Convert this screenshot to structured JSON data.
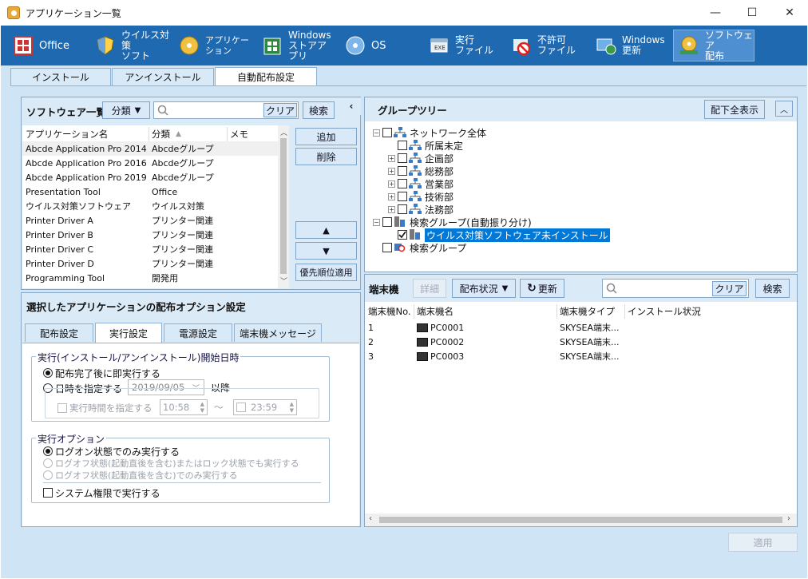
{
  "window": {
    "title": "アプリケーション一覧",
    "minimize": "—",
    "maximize": "☐",
    "close": "✕"
  },
  "ribbon": {
    "office": "Office",
    "antivirus_1": "ウイルス対策",
    "antivirus_2": "ソフト",
    "application": "アプリケーション",
    "store_1": "Windows",
    "store_2": "ストアアプリ",
    "os": "OS",
    "exec_1": "実行",
    "exec_2": "ファイル",
    "notallowed_1": "不許可",
    "notallowed_2": "ファイル",
    "update_1": "Windows",
    "update_2": "更新",
    "software_1": "ソフトウェア",
    "software_2": "配布",
    "colors": {
      "ribbon_bg": "#1f69b1",
      "active_bg": "#4d8fd0"
    }
  },
  "tabs": {
    "install": "インストール",
    "uninstall": "アンインストール",
    "auto": "自動配布設定"
  },
  "software": {
    "title": "ソフトウェア一覧",
    "category_button": "分類",
    "search_value": "",
    "clear": "クリア",
    "search": "検索",
    "col_name": "アプリケーション名",
    "col_category": "分類",
    "col_memo": "メモ",
    "rows": [
      {
        "name": "Abcde Application Pro 2014",
        "category": "Abcdeグループ"
      },
      {
        "name": "Abcde Application Pro 2016",
        "category": "Abcdeグループ"
      },
      {
        "name": "Abcde Application Pro 2019",
        "category": "Abcdeグループ"
      },
      {
        "name": "Presentation Tool",
        "category": "Office"
      },
      {
        "name": "ウイルス対策ソフトウェア",
        "category": "ウイルス対策"
      },
      {
        "name": "Printer Driver A",
        "category": "プリンター関連"
      },
      {
        "name": "Printer Driver B",
        "category": "プリンター関連"
      },
      {
        "name": "Printer Driver C",
        "category": "プリンター関連"
      },
      {
        "name": "Printer Driver D",
        "category": "プリンター関連"
      },
      {
        "name": "Programming Tool",
        "category": "開発用"
      }
    ],
    "add": "追加",
    "delete": "削除",
    "up": "▲",
    "down": "▼",
    "priority": "優先順位適用"
  },
  "options": {
    "title": "選択したアプリケーションの配布オプション設定",
    "tabs": [
      "配布設定",
      "実行設定",
      "電源設定",
      "端末機メッセージ"
    ],
    "group1_label": "実行(インストール/アンインストール)開始日時",
    "opt_immediate": "配布完了後に即実行する",
    "opt_datetime": "日時を指定する",
    "date_value": "2019/09/05",
    "after": "以降",
    "time_range": "実行時間を指定する",
    "time_from": "10:58",
    "tilde": "〜",
    "time_to": "23:59",
    "group2_label": "実行オプション",
    "opt_logon": "ログオン状態でのみ実行する",
    "opt_logoff_lock": "ログオフ状態(起動直後を含む)またはロック状態でも実行する",
    "opt_logoff": "ログオフ状態(起動直後を含む)でのみ実行する",
    "system": "システム権限で実行する"
  },
  "groups": {
    "title": "グループツリー",
    "show_all": "配下全表示",
    "tree": {
      "root": "ネットワーク全体",
      "unassigned": "所属未定",
      "planning": "企画部",
      "general": "総務部",
      "sales": "営業部",
      "tech": "技術部",
      "legal": "法務部",
      "search_auto": "検索グループ(自動振り分け)",
      "not_installed": "ウイルス対策ソフトウェア未インストール",
      "search_group": "検索グループ"
    }
  },
  "terminals": {
    "label": "端末機",
    "detail": "詳細",
    "status": "配布状況",
    "refresh": "更新",
    "search_value": "",
    "clear": "クリア",
    "search": "検索",
    "col_no": "端末機No.",
    "col_name": "端末機名",
    "col_type": "端末機タイプ",
    "col_status": "インストール状況",
    "rows": [
      {
        "no": "1",
        "name": "PC0001",
        "type": "SKYSEA端末..."
      },
      {
        "no": "2",
        "name": "PC0002",
        "type": "SKYSEA端末..."
      },
      {
        "no": "3",
        "name": "PC0003",
        "type": "SKYSEA端末..."
      }
    ]
  },
  "apply": "適用"
}
